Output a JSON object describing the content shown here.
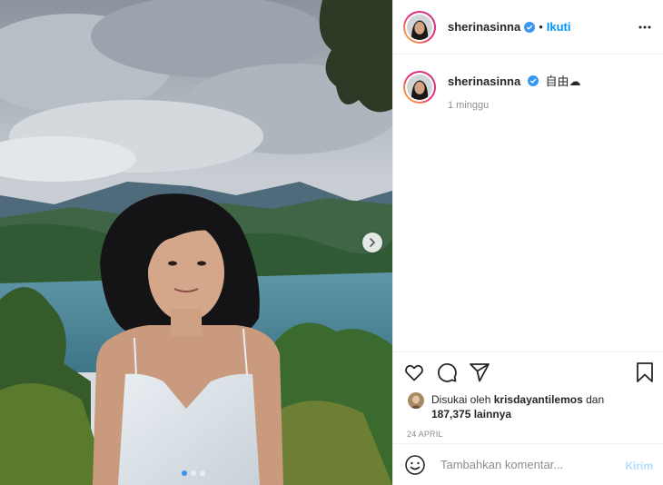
{
  "post": {
    "image_alt": "Woman in white top in front of a lake and mountains",
    "carousel_dots": 3,
    "active_dot": 0
  },
  "header": {
    "username": "sherinasinna",
    "separator": "•",
    "follow_label": "Ikuti",
    "verified_icon": "verified-badge-icon",
    "more_icon": "more-options-icon"
  },
  "caption": {
    "username": "sherinasinna",
    "text": "自由☁",
    "time": "1 minggu"
  },
  "actions": {
    "like_icon": "heart-icon",
    "comment_icon": "comment-icon",
    "share_icon": "share-icon",
    "save_icon": "bookmark-icon"
  },
  "likes": {
    "prefix": "Disukai oleh",
    "user": "krisdayantilemos",
    "conj": "dan",
    "count": "187,375 lainnya"
  },
  "date": "24 APRIL",
  "comment": {
    "placeholder": "Tambahkan komentar...",
    "post_label": "Kirim"
  },
  "colors": {
    "accent": "#0095f6",
    "verified": "#3897f0",
    "muted": "#8e8e8e",
    "border": "#efefef"
  }
}
